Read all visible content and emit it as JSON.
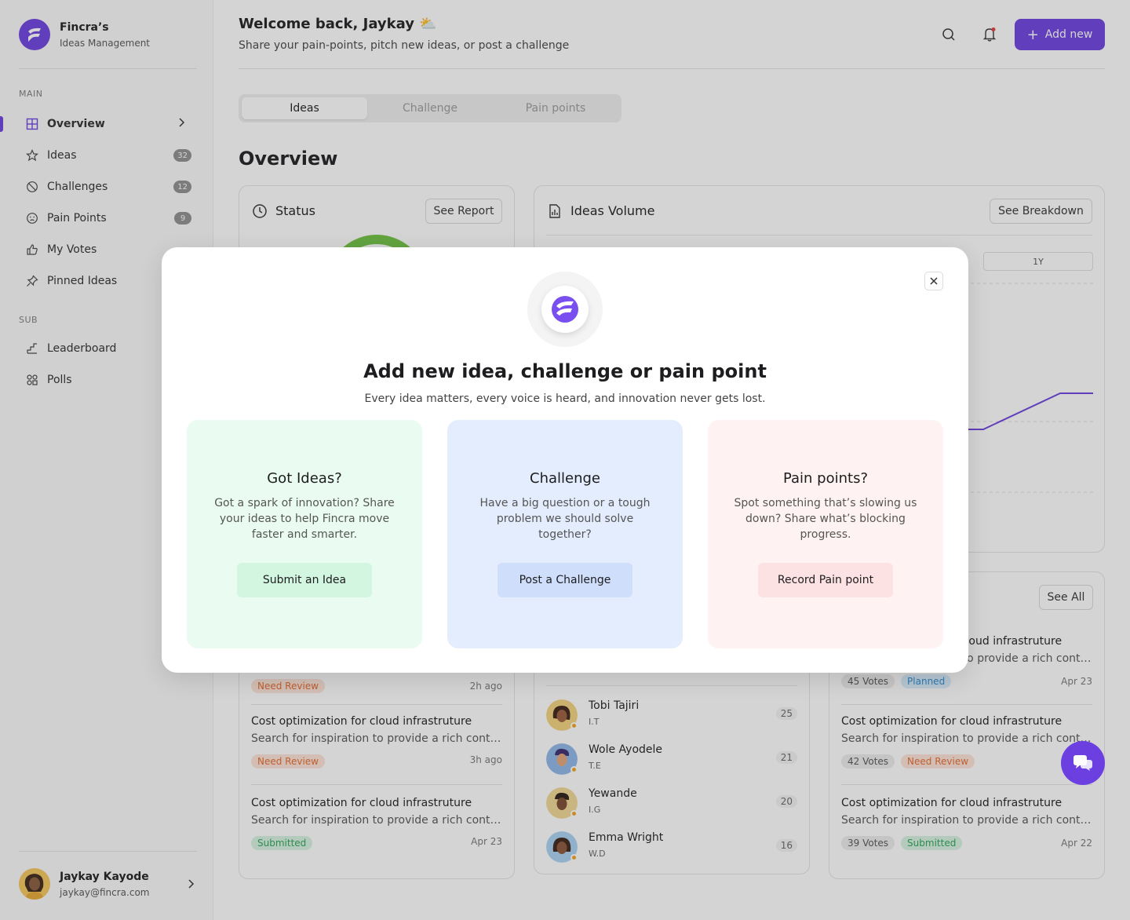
{
  "brand": {
    "name": "Fincra’s",
    "subtitle": "Ideas Management"
  },
  "sidebar": {
    "main_label": "MAIN",
    "sub_label": "SUB",
    "items": [
      {
        "label": "Overview",
        "icon": "grid-icon"
      },
      {
        "label": "Ideas",
        "count": "32",
        "icon": "star-icon"
      },
      {
        "label": "Challenges",
        "count": "12",
        "icon": "prohibit-icon"
      },
      {
        "label": "Pain Points",
        "count": "9",
        "icon": "face-icon"
      },
      {
        "label": "My Votes",
        "icon": "thumbs-up-icon"
      },
      {
        "label": "Pinned Ideas",
        "icon": "pin-icon"
      }
    ],
    "sub_items": [
      {
        "label": "Leaderboard",
        "icon": "stairs-icon"
      },
      {
        "label": "Polls",
        "icon": "polls-icon"
      }
    ]
  },
  "user": {
    "name": "Jaykay Kayode",
    "email": "jaykay@fincra.com"
  },
  "header": {
    "welcome": "Welcome back, Jaykay ⛅",
    "subtitle": "Share your pain-points, pitch new ideas, or post a challenge",
    "add_label": "Add new"
  },
  "tabs": [
    "Ideas",
    "Challenge",
    "Pain points"
  ],
  "overview_title": "Overview",
  "status_card": {
    "title": "Status",
    "button": "See Report"
  },
  "volume_card": {
    "title": "Ideas Volume",
    "button": "See Breakdown",
    "range_label": "1Y"
  },
  "list_card": {
    "button": "See All"
  },
  "ideas_left": [
    {
      "status": "Need Review",
      "time": "2h ago"
    },
    {
      "title": "Cost optimization for cloud infrastruture",
      "desc": "Search for inspiration to provide a rich content for users",
      "status": "Need Review",
      "time": "3h ago"
    },
    {
      "title": "Cost optimization for cloud infrastruture",
      "desc": "Search for inspiration to provide a rich content for users",
      "status": "Submitted",
      "time": "Apr 23"
    }
  ],
  "ideas_right": [
    {
      "title": "Cost optimization for cloud infrastruture",
      "desc": "Search for inspiration to provide a rich content for users",
      "votes": "45 Votes",
      "status": "Planned",
      "time": "Apr 23"
    },
    {
      "title": "Cost optimization for cloud infrastruture",
      "desc": "Search for inspiration to provide a rich content for users",
      "votes": "42 Votes",
      "status": "Need Review",
      "time": ""
    },
    {
      "title": "Cost optimization for cloud infrastruture",
      "desc": "Search for inspiration to provide a rich content for users",
      "votes": "39 Votes",
      "status": "Submitted",
      "time": "Apr 22"
    }
  ],
  "leaderboard": [
    {
      "name": "Tobi Tajiri",
      "dept": "I.T",
      "score": "25"
    },
    {
      "name": "Wole Ayodele",
      "dept": "T.E",
      "score": "21"
    },
    {
      "name": "Yewande",
      "dept": "I.G",
      "score": "20"
    },
    {
      "name": "Emma Wright",
      "dept": "W.D",
      "score": "16"
    }
  ],
  "modal": {
    "title": "Add new idea, challenge or pain point",
    "subtitle": "Every idea matters, every voice is heard, and innovation never gets lost.",
    "options": [
      {
        "title": "Got Ideas?",
        "desc": "Got a spark of innovation? Share your ideas to help Fincra move faster and smarter.",
        "button": "Submit an Idea",
        "bg": "#eafcf1",
        "btn_bg": "#d3f6e1"
      },
      {
        "title": "Challenge",
        "desc": "Have a big question or a tough problem we should solve together?",
        "button": "Post a Challenge",
        "bg": "#e4edfd",
        "btn_bg": "#cfdefb"
      },
      {
        "title": "Pain points?",
        "desc": "Spot something that’s slowing us down? Share what’s blocking progress.",
        "button": "Record Pain point",
        "bg": "#fef3f2",
        "btn_bg": "#fde2e4"
      }
    ]
  },
  "colors": {
    "accent": "#6b3fe0"
  }
}
